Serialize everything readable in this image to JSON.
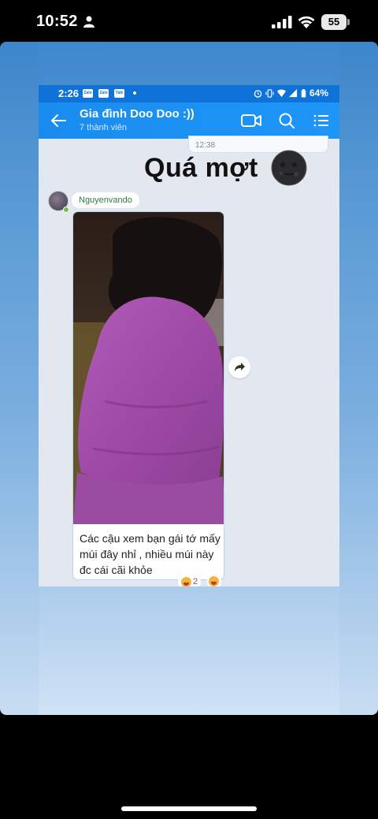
{
  "ios_status": {
    "time": "10:52",
    "battery": "55"
  },
  "android_status": {
    "time": "2:26",
    "app_badges": [
      "Zalo",
      "Zalo",
      "Talk"
    ],
    "battery": "64%"
  },
  "header": {
    "title": "Gia đình Doo Doo :))",
    "subtitle": "7 thành viên"
  },
  "chat": {
    "timestamp": "12:38",
    "overlay_caption": "Quá mợt",
    "sender": "Nguyenvando",
    "message": "Các cậu xem bạn gái tớ mấy múi đây nhỉ , nhiều múi này đc cái cãi khỏe",
    "reaction_count": "2"
  },
  "colors": {
    "header_blue": "#1a8cf0",
    "status_blue": "#0e72d9",
    "chat_bg": "#e3e8f0",
    "sender_green": "#2f7b43"
  },
  "icons": [
    "person-icon",
    "signal-icon",
    "wifi-icon",
    "battery-icon",
    "back-arrow-icon",
    "video-call-icon",
    "search-icon",
    "menu-list-icon",
    "share-forward-icon",
    "moon-face-emoji",
    "laugh-reaction-icon"
  ]
}
